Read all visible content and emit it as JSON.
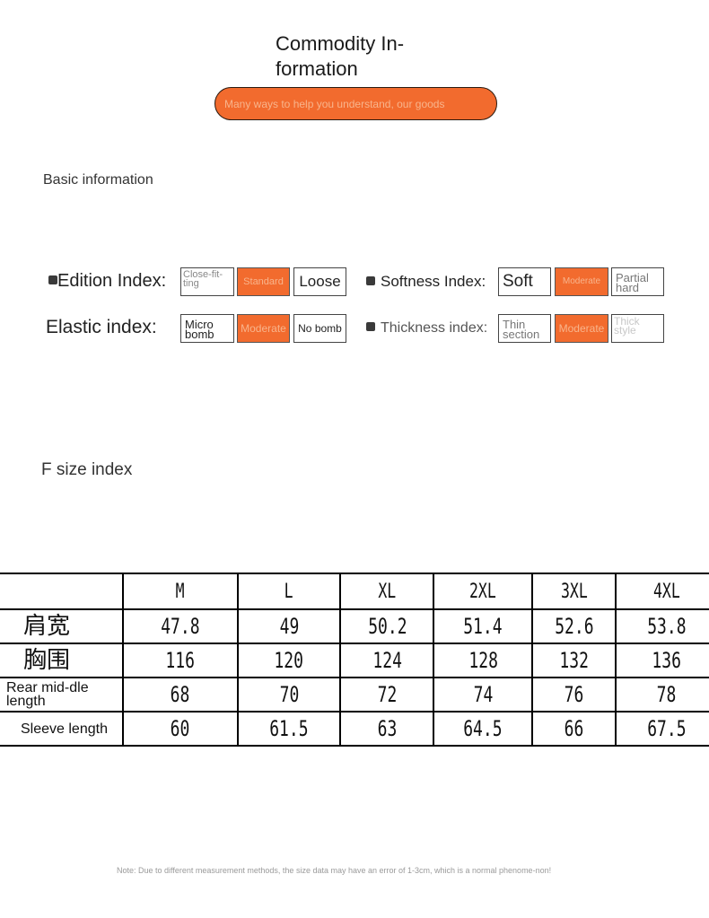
{
  "header": {
    "title": "Commodity In-formation",
    "subtitle": "Many ways to help you understand, our goods"
  },
  "colors": {
    "accent": "#f26b2e",
    "accent_text": "#f8b48c"
  },
  "basic": {
    "section_label": "Basic information",
    "indices": [
      {
        "label": "Edition Index:",
        "options": [
          "Close-fit-ting",
          "Standard",
          "Loose"
        ],
        "selected": "Standard"
      },
      {
        "label": "Softness Index:",
        "options": [
          "Soft",
          "Moderate",
          "Partial hard"
        ],
        "selected": "Moderate"
      },
      {
        "label": "Elastic index:",
        "options": [
          "Micro bomb",
          "Moderate",
          "No bomb"
        ],
        "selected": "Moderate"
      },
      {
        "label": "Thickness index:",
        "options": [
          "Thin section",
          "Moderate",
          "Thick style"
        ],
        "selected": "Moderate"
      }
    ]
  },
  "size": {
    "section_label": "F size index",
    "columns": [
      "",
      "M",
      "L",
      "XL",
      "2XL",
      "3XL",
      "4XL"
    ],
    "rows": [
      {
        "label": "肩宽",
        "values": [
          "47.8",
          "49",
          "50.2",
          "51.4",
          "52.6",
          "53.8"
        ]
      },
      {
        "label": "胸围",
        "values": [
          "116",
          "120",
          "124",
          "128",
          "132",
          "136"
        ]
      },
      {
        "label": "Rear mid-dle length",
        "values": [
          "68",
          "70",
          "72",
          "74",
          "76",
          "78"
        ]
      },
      {
        "label": "Sleeve length",
        "values": [
          "60",
          "61.5",
          "63",
          "64.5",
          "66",
          "67.5"
        ]
      }
    ]
  },
  "note": "Note: Due to different measurement methods, the size data may have an error of 1-3cm, which is a normal phenome-non!"
}
